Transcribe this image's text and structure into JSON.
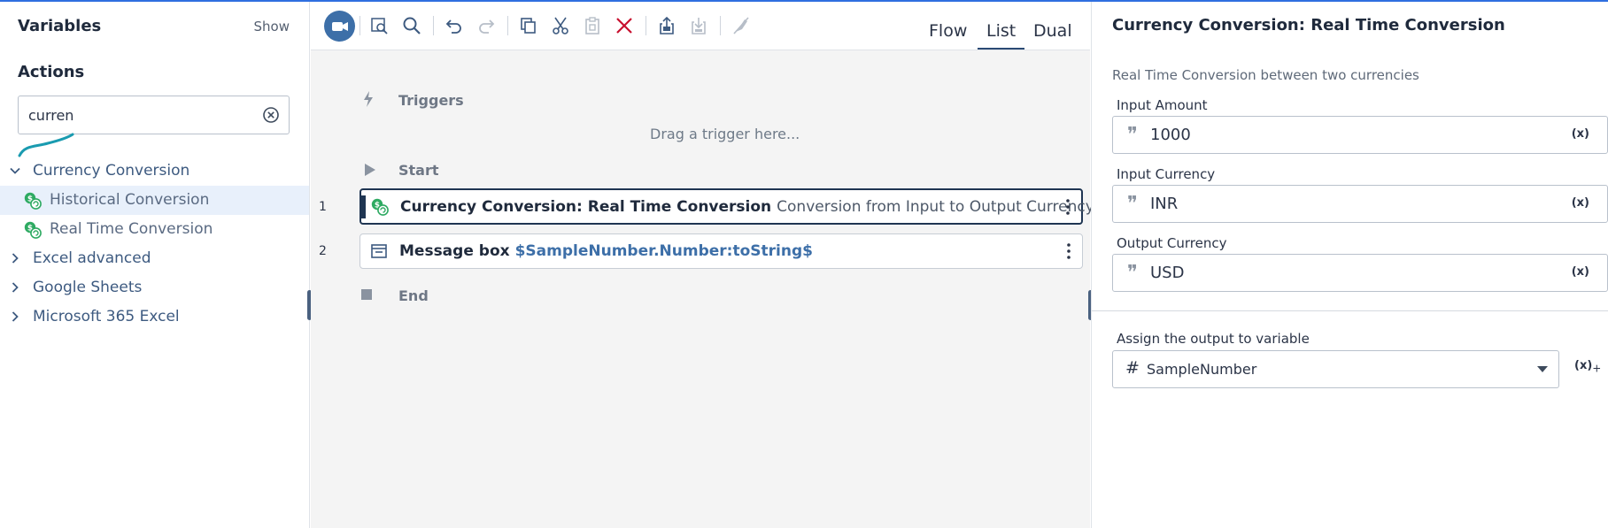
{
  "left_panel": {
    "variables_title": "Variables",
    "show_label": "Show",
    "actions_title": "Actions",
    "search": {
      "value": "curren",
      "placeholder": ""
    },
    "tree": [
      {
        "label": "Currency Conversion",
        "expanded": true
      },
      {
        "label": "Historical Conversion",
        "child": true,
        "selected": true
      },
      {
        "label": "Real Time Conversion",
        "child": true
      },
      {
        "label": "Excel advanced",
        "expanded": false
      },
      {
        "label": "Google Sheets",
        "expanded": false
      },
      {
        "label": "Microsoft 365 Excel",
        "expanded": false
      }
    ]
  },
  "toolbar": {
    "icons": [
      "record-icon",
      "find-icon",
      "search-icon",
      "undo-icon",
      "redo-icon",
      "copy-icon",
      "cut-icon",
      "paste-icon",
      "delete-icon",
      "export-icon",
      "import-icon",
      "disable-icon"
    ],
    "tabs": [
      "Flow",
      "List",
      "Dual"
    ],
    "active_tab": "List"
  },
  "flow": {
    "triggers_label": "Triggers",
    "drag_hint": "Drag a trigger here...",
    "start_label": "Start",
    "end_label": "End",
    "steps": [
      {
        "num": "1",
        "title": "Currency Conversion: Real Time Conversion",
        "description": "Conversion from Input to Output Currency"
      },
      {
        "num": "2",
        "title": "Message box",
        "variable": "$SampleNumber.Number:toString$"
      }
    ]
  },
  "properties": {
    "title": "Currency Conversion: Real Time Conversion",
    "description": "Real Time Conversion between two currencies",
    "fields": [
      {
        "label": "Input Amount",
        "value": "1000",
        "var_btn": "(x)"
      },
      {
        "label": "Input Currency",
        "value": "INR",
        "var_btn": "(x)"
      },
      {
        "label": "Output Currency",
        "value": "USD",
        "var_btn": "(x)"
      }
    ],
    "assign_label": "Assign the output to variable",
    "assign_value": "SampleNumber",
    "assign_prefix": "#",
    "add_var_btn": "(x)",
    "add_var_plus": "+"
  },
  "colors": {
    "accent": "#3d6fa8",
    "topline": "#2f6fe0",
    "selected_bg": "#e8f0fb",
    "delete_red": "#c8102e"
  }
}
